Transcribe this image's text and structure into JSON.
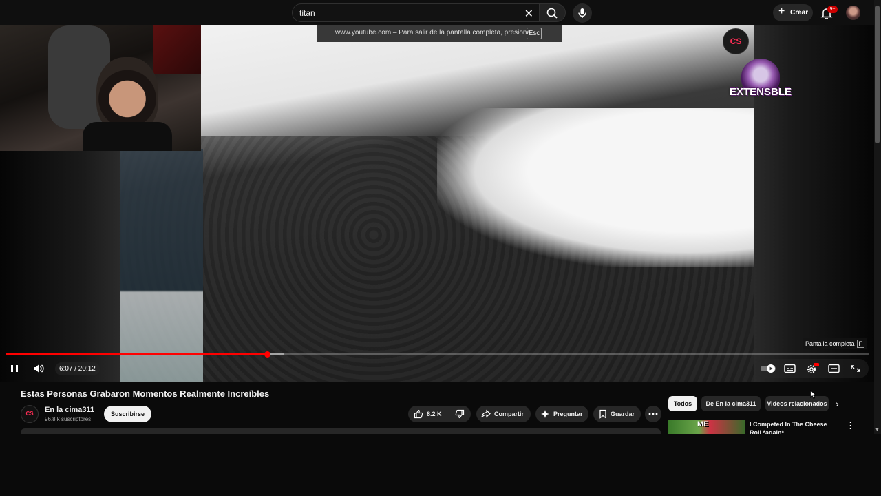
{
  "search": {
    "query": "titan"
  },
  "header": {
    "create_label": "Crear",
    "notifications_badge": "9+"
  },
  "player": {
    "fullscreen_notice": "www.youtube.com – Para salir de la pantalla completa, presiona",
    "fullscreen_notice_key": "Esc",
    "watermark_logo_text": "CS",
    "overlay_brand": "EXTENSBLE",
    "tooltip_label": "Pantalla completa",
    "tooltip_key": "F",
    "time_display": "6:07 / 20:12",
    "progress_fraction": 0.303,
    "buffered_fraction": 0.323,
    "state": "playing",
    "autoplay": "on"
  },
  "video": {
    "title": "Estas Personas Grabaron Momentos Realmente Increíbles",
    "channel_name": "En la cima311",
    "channel_avatar_text": "CS",
    "subscribers": "96.8 k suscriptores",
    "subscribe_label": "Suscribirse",
    "like_count": "8.2 K",
    "share_label": "Compartir",
    "ask_label": "Preguntar",
    "save_label": "Guardar"
  },
  "related": {
    "chips": [
      "Todos",
      "De En la cima311",
      "Videos relacionados"
    ],
    "active_chip": "Todos",
    "items": [
      {
        "title": "I Competed In The Cheese Roll *again*",
        "thumb_text": "ME"
      }
    ]
  },
  "colors": {
    "accent": "#ff0000",
    "background": "#0f0f0f",
    "chip_active": "#f1f1f1",
    "button_bg": "#272727"
  }
}
